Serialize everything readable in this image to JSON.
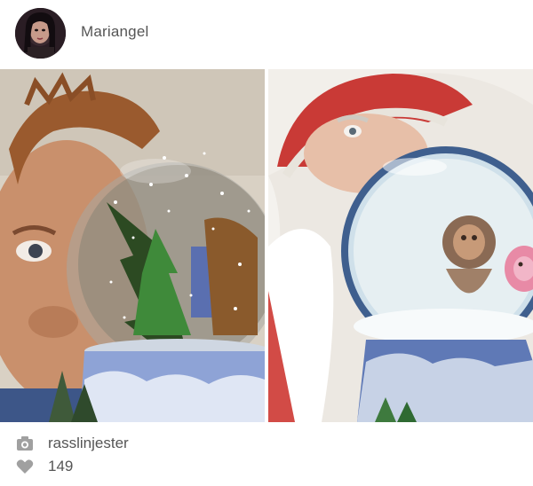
{
  "post": {
    "author": {
      "username": "Mariangel",
      "avatar_icon": "profile-avatar"
    },
    "photos": [
      {
        "subject": "man-snow-globe-photo"
      },
      {
        "subject": "santa-snow-globe-painting"
      }
    ],
    "credit": {
      "icon": "camera-icon",
      "text": "rasslinjester"
    },
    "likes": {
      "icon": "heart-icon",
      "count": "149"
    }
  },
  "colors": {
    "text_primary": "#555555",
    "icon_gray": "#a0a0a0",
    "background": "#ffffff"
  }
}
